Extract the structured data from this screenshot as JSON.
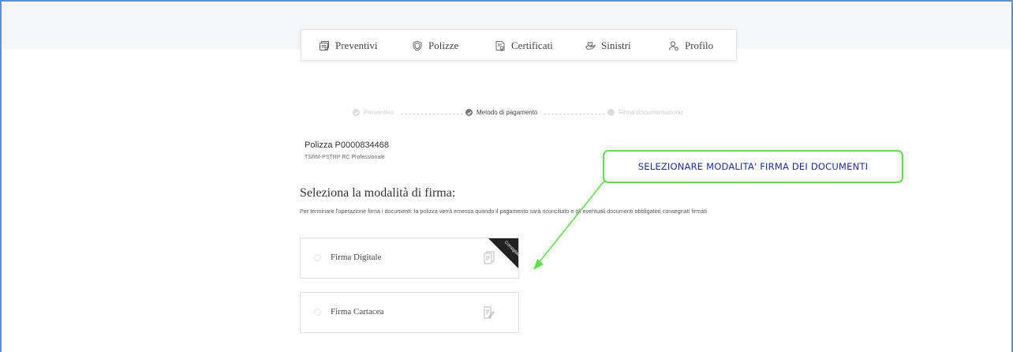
{
  "nav": {
    "items": [
      {
        "label": "Preventivi",
        "icon": "quote-doc-icon"
      },
      {
        "label": "Polizze",
        "icon": "shield-icon"
      },
      {
        "label": "Certificati",
        "icon": "certificate-icon"
      },
      {
        "label": "Sinistri",
        "icon": "claims-hand-icon"
      },
      {
        "label": "Profilo",
        "icon": "user-icon"
      }
    ]
  },
  "stepper": {
    "steps": [
      {
        "label": "Preventivo",
        "state": "done"
      },
      {
        "label": "Metodo di pagamento",
        "state": "active"
      },
      {
        "label": "Firma documentazione",
        "state": "pending"
      }
    ]
  },
  "policy": {
    "title": "Polizza P0000834468",
    "subtitle": "TSRM-PSTRP RC Professionale"
  },
  "signature": {
    "heading": "Seleziona la modalità di firma:",
    "description": "Per terminare l'operazione firma i documenti: la polizza verrà emessa quando il pagamento sarà riconciliato e gli eventuali documenti obbligatori consegnati firmati",
    "options": [
      {
        "label": "Firma Digitale",
        "badge": "Consigliata",
        "icon": "digital-signature-icon"
      },
      {
        "label": "Firma Cartacea",
        "badge": "",
        "icon": "paper-signature-icon"
      }
    ]
  },
  "annotation": {
    "text": "SELEZIONARE MODALITA' FIRMA DEI DOCUMENTI",
    "color": "#5ee048",
    "text_color": "#1b2fa3"
  },
  "colors": {
    "frame": "#5b8fd6",
    "header_band": "#f5f6f8",
    "ribbon": "#222222"
  }
}
